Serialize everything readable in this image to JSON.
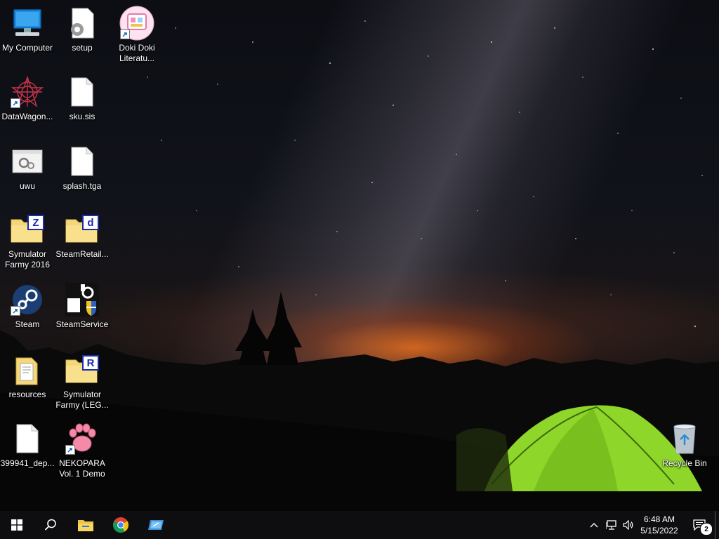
{
  "desktop": {
    "icons": [
      {
        "label": "My Computer",
        "type": "computer"
      },
      {
        "label": "setup",
        "type": "setup-file"
      },
      {
        "label": "Doki Doki Literatu...",
        "type": "ddlc"
      },
      {
        "label": "DataWagon...",
        "type": "datawagon"
      },
      {
        "label": "sku.sis",
        "type": "file"
      },
      {
        "label": "uwu",
        "type": "config-window"
      },
      {
        "label": "splash.tga",
        "type": "file"
      },
      {
        "label": "Symulator Farmy 2016",
        "type": "folder",
        "badge": "Z"
      },
      {
        "label": "SteamRetail...",
        "type": "folder",
        "badge": "d"
      },
      {
        "label": "Steam",
        "type": "steam"
      },
      {
        "label": "SteamService",
        "type": "steam-service"
      },
      {
        "label": "resources",
        "type": "folder-docs"
      },
      {
        "label": "Symulator Farmy (LEG...",
        "type": "folder",
        "badge": "R"
      },
      {
        "label": "399941_dep...",
        "type": "file"
      },
      {
        "label": "NEKOPARA Vol. 1 Demo",
        "type": "nekopara"
      },
      {
        "label": "Recycle Bin",
        "type": "recycle-bin"
      }
    ]
  },
  "taskbar": {
    "pinned": [
      "start-icon",
      "search-icon",
      "file-explorer-icon",
      "chrome-icon",
      "remote-desktop-icon"
    ],
    "tray": {
      "time": "6:48 AM",
      "date": "5/15/2022",
      "notification_count": "2"
    }
  },
  "colors": {
    "folder": "#f4d77a",
    "tent": "#8fd62a",
    "taskbar": "#0e0e10",
    "sunset": "#e0702a"
  }
}
